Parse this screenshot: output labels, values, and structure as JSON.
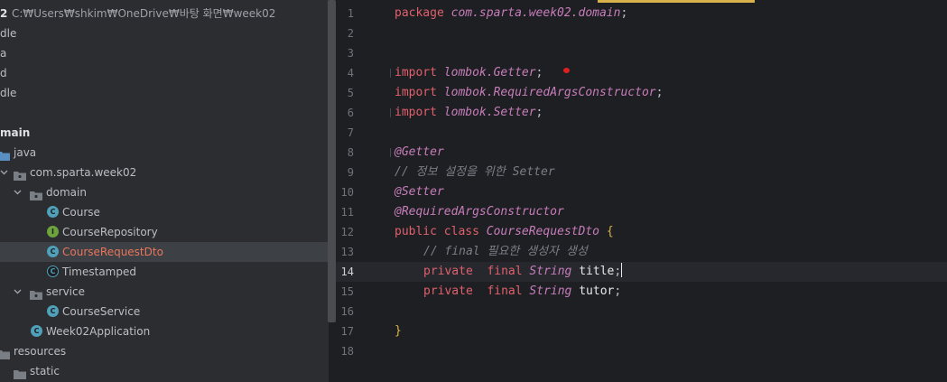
{
  "project": {
    "root_label": "2",
    "root_path": "C:₩Users₩shkim₩OneDrive₩바탕 화면₩week02",
    "items": [
      {
        "label": "dle"
      },
      {
        "label": "a"
      },
      {
        "label": "d"
      },
      {
        "label": "dle"
      },
      {
        "label": "main"
      },
      {
        "label": "java"
      },
      {
        "label": "com.sparta.week02"
      },
      {
        "label": "domain"
      },
      {
        "label": "Course"
      },
      {
        "label": "CourseRepository"
      },
      {
        "label": "CourseRequestDto"
      },
      {
        "label": "Timestamped"
      },
      {
        "label": "service"
      },
      {
        "label": "CourseService"
      },
      {
        "label": "Week02Application"
      },
      {
        "label": "resources"
      },
      {
        "label": "static"
      }
    ]
  },
  "editor": {
    "current_line": "14",
    "line_numbers": [
      "1",
      "2",
      "3",
      "4",
      "5",
      "6",
      "7",
      "8",
      "9",
      "10",
      "11",
      "12",
      "13",
      "14",
      "15",
      "16",
      "17",
      "18"
    ],
    "code": {
      "l1": [
        "package",
        "com.sparta.week02.domain",
        ";"
      ],
      "l4": [
        "import",
        "lombok.Getter",
        ";"
      ],
      "l5": [
        "import",
        "lombok.RequiredArgsConstructor",
        ";"
      ],
      "l6": [
        "import",
        "lombok.Setter",
        ";"
      ],
      "l8": "@Getter",
      "l9": "// 정보 설정을 위한 Setter",
      "l10": "@Setter",
      "l11": "@RequiredArgsConstructor",
      "l12": [
        "public",
        "class",
        "CourseRequestDto",
        "{"
      ],
      "l13": "// final 필요한 생성자 생성",
      "l14": [
        "private",
        "final",
        "String",
        "title",
        ";"
      ],
      "l15": [
        "private",
        "final",
        "String",
        "tutor",
        ";"
      ],
      "l17": "}"
    }
  },
  "colors": {
    "keyword": "#e0606d",
    "identifier_italic": "#c77dbb",
    "comment": "#7a7e85",
    "brace": "#d9b24c",
    "class_icon": "#4fa0b8",
    "interface_icon": "#6ea23c"
  },
  "icons": [
    "chevron-down-icon",
    "folder-icon",
    "package-icon",
    "class-icon",
    "interface-icon",
    "spring-app-icon",
    "breakpoint-dot-icon"
  ]
}
